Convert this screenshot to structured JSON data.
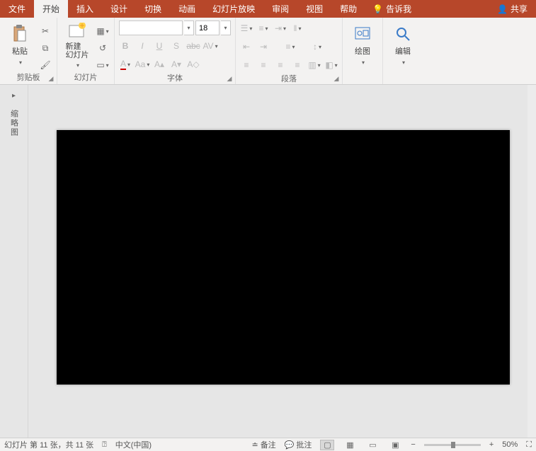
{
  "tabs": {
    "file": "文件",
    "home": "开始",
    "insert": "插入",
    "design": "设计",
    "transitions": "切换",
    "animations": "动画",
    "slideshow": "幻灯片放映",
    "review": "审阅",
    "view": "视图",
    "help": "帮助",
    "tellme": "告诉我",
    "share": "共享"
  },
  "ribbon": {
    "clipboard": {
      "paste": "粘贴",
      "label": "剪贴板"
    },
    "slides": {
      "new_slide": "新建\n幻灯片",
      "label": "幻灯片"
    },
    "font": {
      "size": "18",
      "label": "字体"
    },
    "paragraph": {
      "label": "段落"
    },
    "drawing": {
      "btn": "绘图",
      "label": ""
    },
    "editing": {
      "btn": "编辑",
      "label": ""
    }
  },
  "thumb": {
    "label": "缩略图"
  },
  "status": {
    "slide": "幻灯片 第 11 张，共 11 张",
    "lang": "中文(中国)",
    "notes": "备注",
    "comments": "批注",
    "zoom": "50%"
  }
}
